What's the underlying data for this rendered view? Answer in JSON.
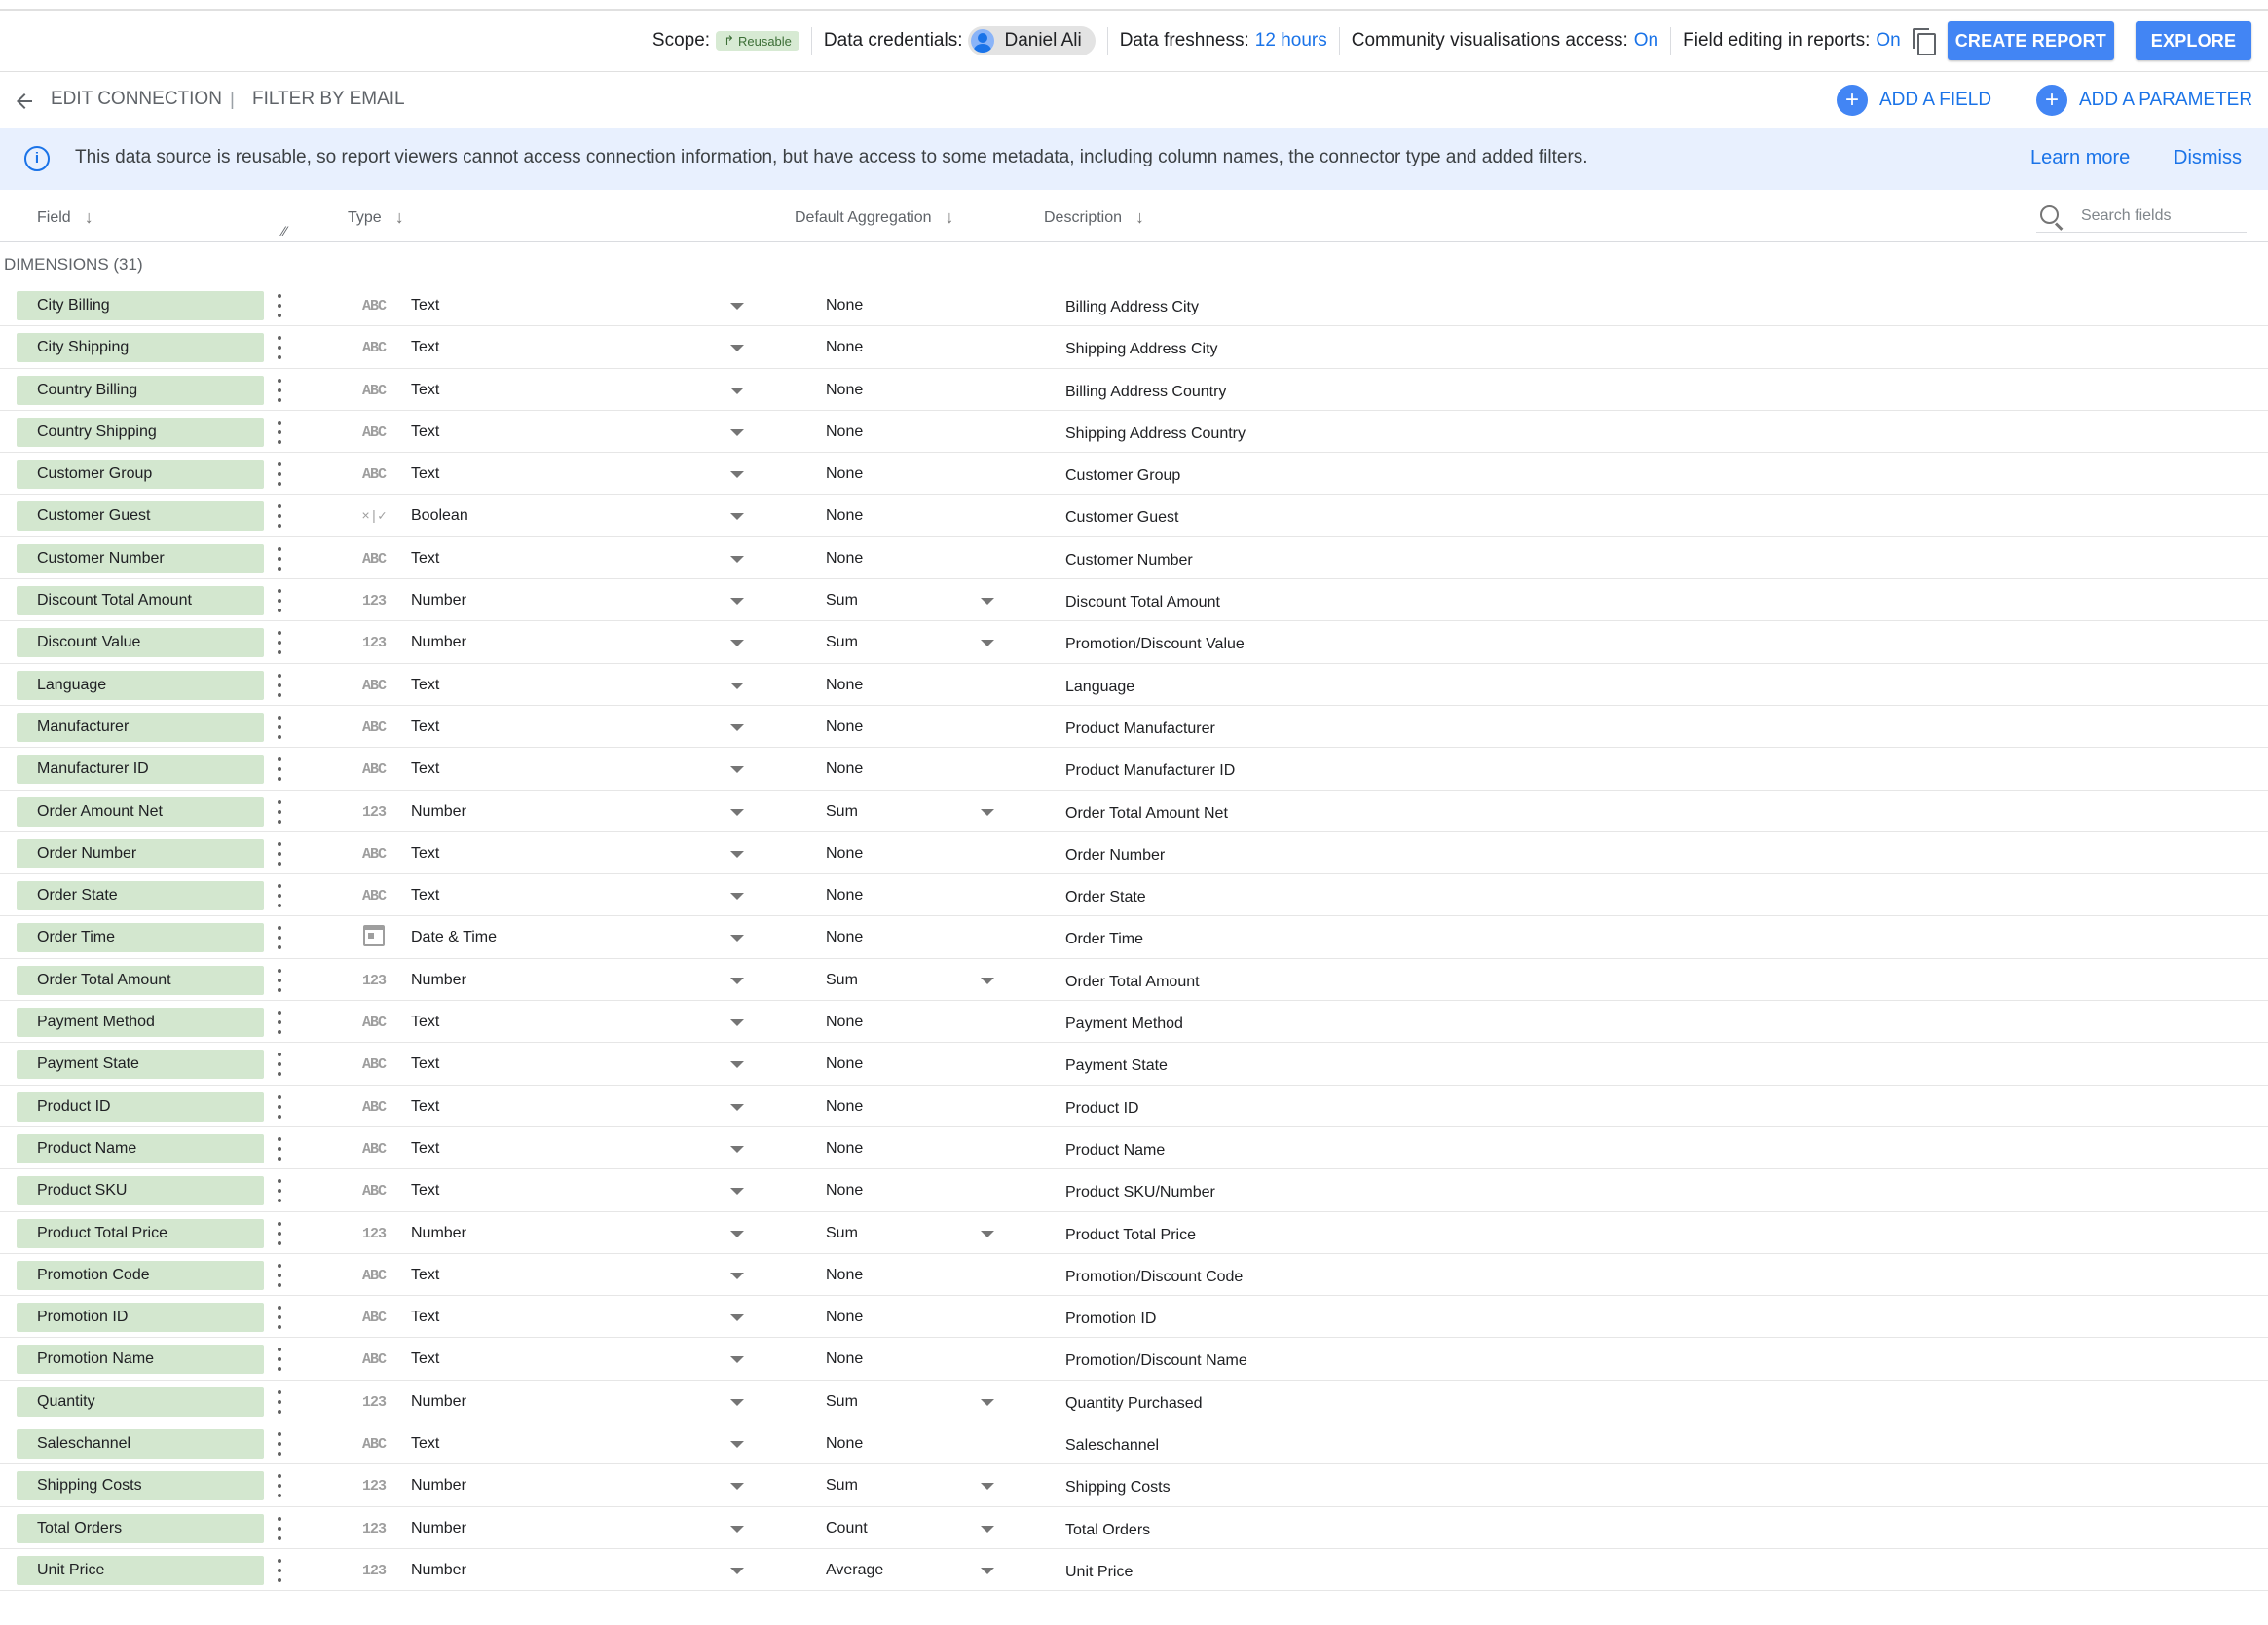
{
  "topbar": {
    "scope_label": "Scope:",
    "scope_value": "Reusable",
    "credentials_label": "Data credentials:",
    "credentials_user": "Daniel Ali",
    "freshness_label": "Data freshness:",
    "freshness_value": "12 hours",
    "community_label": "Community visualisations access:",
    "community_value": "On",
    "field_editing_label": "Field editing in reports:",
    "field_editing_value": "On",
    "create_report": "CREATE REPORT",
    "explore": "EXPLORE"
  },
  "nav": {
    "edit_connection": "EDIT CONNECTION",
    "filter_by_email": "FILTER BY EMAIL",
    "add_field": "ADD A FIELD",
    "add_parameter": "ADD A PARAMETER"
  },
  "banner": {
    "text": "This data source is reusable, so report viewers cannot access connection information, but have access to some metadata, including column names, the connector type and added filters.",
    "learn_more": "Learn more",
    "dismiss": "Dismiss"
  },
  "columns": {
    "field": "Field",
    "type": "Type",
    "aggregation": "Default Aggregation",
    "description": "Description",
    "search_placeholder": "Search fields"
  },
  "dimensions": {
    "label": "DIMENSIONS (31)",
    "rows": [
      {
        "field": "City Billing",
        "icon": "ABC",
        "type": "Text",
        "agg": "None",
        "agg_menu": false,
        "desc": "Billing Address City"
      },
      {
        "field": "City Shipping",
        "icon": "ABC",
        "type": "Text",
        "agg": "None",
        "agg_menu": false,
        "desc": "Shipping Address City"
      },
      {
        "field": "Country Billing",
        "icon": "ABC",
        "type": "Text",
        "agg": "None",
        "agg_menu": false,
        "desc": "Billing Address Country"
      },
      {
        "field": "Country Shipping",
        "icon": "ABC",
        "type": "Text",
        "agg": "None",
        "agg_menu": false,
        "desc": "Shipping Address Country"
      },
      {
        "field": "Customer Group",
        "icon": "ABC",
        "type": "Text",
        "agg": "None",
        "agg_menu": false,
        "desc": "Customer Group"
      },
      {
        "field": "Customer Guest",
        "icon": "×|✓",
        "type": "Boolean",
        "agg": "None",
        "agg_menu": false,
        "desc": "Customer Guest"
      },
      {
        "field": "Customer Number",
        "icon": "ABC",
        "type": "Text",
        "agg": "None",
        "agg_menu": false,
        "desc": "Customer Number"
      },
      {
        "field": "Discount Total Amount",
        "icon": "123",
        "type": "Number",
        "agg": "Sum",
        "agg_menu": true,
        "desc": "Discount Total Amount"
      },
      {
        "field": "Discount Value",
        "icon": "123",
        "type": "Number",
        "agg": "Sum",
        "agg_menu": true,
        "desc": "Promotion/Discount Value"
      },
      {
        "field": "Language",
        "icon": "ABC",
        "type": "Text",
        "agg": "None",
        "agg_menu": false,
        "desc": "Language"
      },
      {
        "field": "Manufacturer",
        "icon": "ABC",
        "type": "Text",
        "agg": "None",
        "agg_menu": false,
        "desc": "Product Manufacturer"
      },
      {
        "field": "Manufacturer ID",
        "icon": "ABC",
        "type": "Text",
        "agg": "None",
        "agg_menu": false,
        "desc": "Product Manufacturer ID"
      },
      {
        "field": "Order Amount Net",
        "icon": "123",
        "type": "Number",
        "agg": "Sum",
        "agg_menu": true,
        "desc": "Order Total Amount Net"
      },
      {
        "field": "Order Number",
        "icon": "ABC",
        "type": "Text",
        "agg": "None",
        "agg_menu": false,
        "desc": "Order Number"
      },
      {
        "field": "Order State",
        "icon": "ABC",
        "type": "Text",
        "agg": "None",
        "agg_menu": false,
        "desc": "Order State"
      },
      {
        "field": "Order Time",
        "icon": "calendar",
        "type": "Date & Time",
        "agg": "None",
        "agg_menu": false,
        "desc": "Order Time"
      },
      {
        "field": "Order Total Amount",
        "icon": "123",
        "type": "Number",
        "agg": "Sum",
        "agg_menu": true,
        "desc": "Order Total Amount"
      },
      {
        "field": "Payment Method",
        "icon": "ABC",
        "type": "Text",
        "agg": "None",
        "agg_menu": false,
        "desc": "Payment Method"
      },
      {
        "field": "Payment State",
        "icon": "ABC",
        "type": "Text",
        "agg": "None",
        "agg_menu": false,
        "desc": "Payment State"
      },
      {
        "field": "Product ID",
        "icon": "ABC",
        "type": "Text",
        "agg": "None",
        "agg_menu": false,
        "desc": "Product ID"
      },
      {
        "field": "Product Name",
        "icon": "ABC",
        "type": "Text",
        "agg": "None",
        "agg_menu": false,
        "desc": "Product Name"
      },
      {
        "field": "Product SKU",
        "icon": "ABC",
        "type": "Text",
        "agg": "None",
        "agg_menu": false,
        "desc": "Product SKU/Number"
      },
      {
        "field": "Product Total Price",
        "icon": "123",
        "type": "Number",
        "agg": "Sum",
        "agg_menu": true,
        "desc": "Product Total Price"
      },
      {
        "field": "Promotion Code",
        "icon": "ABC",
        "type": "Text",
        "agg": "None",
        "agg_menu": false,
        "desc": "Promotion/Discount Code"
      },
      {
        "field": "Promotion ID",
        "icon": "ABC",
        "type": "Text",
        "agg": "None",
        "agg_menu": false,
        "desc": "Promotion ID"
      },
      {
        "field": "Promotion Name",
        "icon": "ABC",
        "type": "Text",
        "agg": "None",
        "agg_menu": false,
        "desc": "Promotion/Discount Name"
      },
      {
        "field": "Quantity",
        "icon": "123",
        "type": "Number",
        "agg": "Sum",
        "agg_menu": true,
        "desc": "Quantity Purchased"
      },
      {
        "field": "Saleschannel",
        "icon": "ABC",
        "type": "Text",
        "agg": "None",
        "agg_menu": false,
        "desc": "Saleschannel"
      },
      {
        "field": "Shipping Costs",
        "icon": "123",
        "type": "Number",
        "agg": "Sum",
        "agg_menu": true,
        "desc": "Shipping Costs"
      },
      {
        "field": "Total Orders",
        "icon": "123",
        "type": "Number",
        "agg": "Count",
        "agg_menu": true,
        "desc": "Total Orders"
      },
      {
        "field": "Unit Price",
        "icon": "123",
        "type": "Number",
        "agg": "Average",
        "agg_menu": true,
        "desc": "Unit Price"
      }
    ]
  },
  "colors": {
    "accent": "#4285f4",
    "link": "#1a73e8",
    "chip": "#d3e7cf",
    "banner": "#e8f0fe"
  }
}
